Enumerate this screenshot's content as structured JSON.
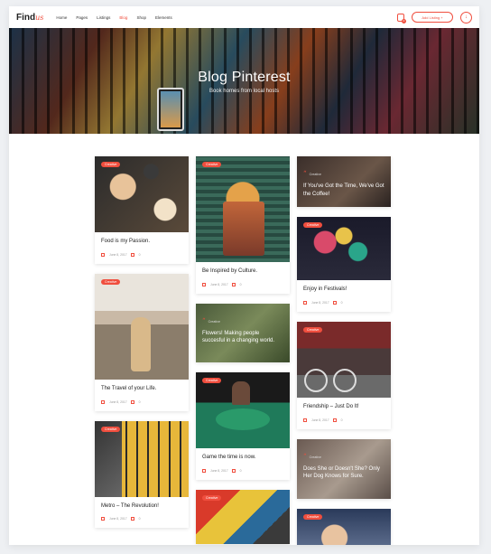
{
  "header": {
    "logo_main": "Find",
    "logo_accent": "us",
    "nav": [
      "Home",
      "Pages",
      "Listings",
      "Blog",
      "Shop",
      "Elements"
    ],
    "active_nav": "Blog",
    "cart_count": "0",
    "add_listing": "Add Listing +"
  },
  "hero": {
    "title": "Blog Pinterest",
    "subtitle": "Book homes from local hosts"
  },
  "cards": {
    "c1": {
      "badge": "Creative",
      "title": "Food is my Passion.",
      "date": "June 8, 2017",
      "comments": "0"
    },
    "c2": {
      "badge": "Creative",
      "title": "The Travel of your Life.",
      "date": "June 8, 2017",
      "comments": "0"
    },
    "c3": {
      "badge": "Creative",
      "title": "Metro – The Revolution!",
      "date": "June 8, 2017",
      "comments": "0"
    },
    "c4": {
      "badge": "Creative",
      "title": "Be Inspired by Culture.",
      "date": "June 8, 2017",
      "comments": "0"
    },
    "c5": {
      "badge": "Creative",
      "text": "Flowers! Making people succesful in a changing world."
    },
    "c6": {
      "badge": "Creative",
      "title": "Game the time is now.",
      "date": "June 8, 2017",
      "comments": "0"
    },
    "c7": {
      "badge": "Creative"
    },
    "c8": {
      "badge": "Creative",
      "text": "If You've Got the Time, We've Got the Coffee!"
    },
    "c9": {
      "badge": "Creative",
      "title": "Enjoy in Festivals!",
      "date": "June 8, 2017",
      "comments": "0"
    },
    "c10": {
      "badge": "Creative",
      "title": "Friendship – Just Do It!",
      "date": "June 8, 2017",
      "comments": "0"
    },
    "c11": {
      "badge": "Creative",
      "text": "Does She or Doesn't She? Only Her Dog Knows for Sure."
    },
    "c12": {
      "badge": "Creative"
    }
  },
  "colors": {
    "accent": "#f04e3e"
  }
}
